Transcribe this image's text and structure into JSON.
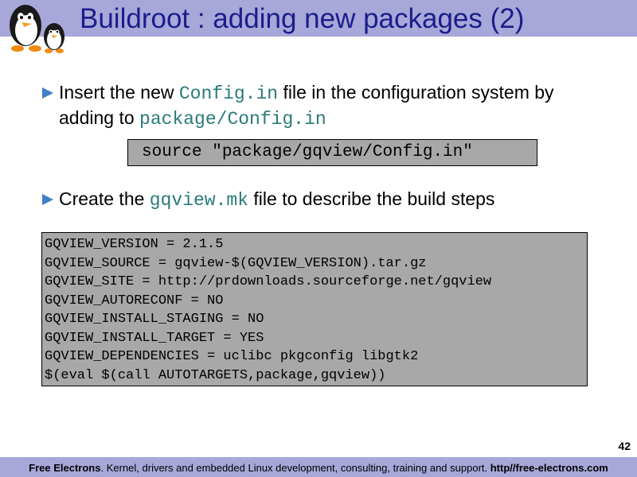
{
  "header": {
    "title": "Buildroot : adding new packages (2)",
    "logo_icon": "penguins-logo-icon"
  },
  "bullets": [
    {
      "parts": [
        "Insert the new ",
        "Config.in",
        " file in the configuration system by",
        "adding to ",
        "package/Config.in"
      ]
    },
    {
      "parts": [
        "Create the ",
        "gqview.mk",
        " file to describe the build steps"
      ]
    }
  ],
  "source_line": "source \"package/gqview/Config.in\"",
  "code_lines": [
    "GQVIEW_VERSION = 2.1.5",
    "GQVIEW_SOURCE = gqview-$(GQVIEW_VERSION).tar.gz",
    "GQVIEW_SITE = http://prdownloads.sourceforge.net/gqview",
    "GQVIEW_AUTORECONF = NO",
    "GQVIEW_INSTALL_STAGING = NO",
    "GQVIEW_INSTALL_TARGET = YES",
    "GQVIEW_DEPENDENCIES = uclibc pkgconfig libgtk2",
    "$(eval $(call AUTOTARGETS,package,gqview))"
  ],
  "page_number": "42",
  "footer": {
    "brand": "Free Electrons",
    "description": ". Kernel, drivers and embedded Linux development, consulting, training and support. ",
    "url": "http//free-electrons.com"
  },
  "colors": {
    "bar": "#a7a7d9",
    "title": "#1c1c8c",
    "code_bg": "#a8a8a8",
    "mono_text": "#2a7a7a",
    "bullet": "#3f7fc8"
  }
}
